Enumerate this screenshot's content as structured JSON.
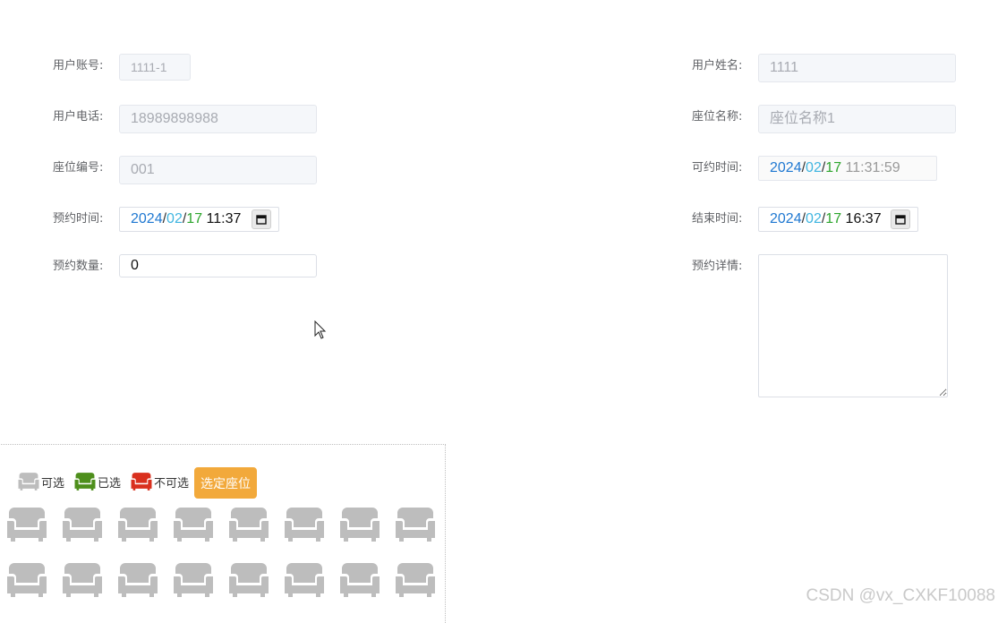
{
  "form": {
    "account_label": "用户账号:",
    "account_value": "1111-1",
    "name_label": "用户姓名:",
    "name_value": "1111",
    "phone_label": "用户电话:",
    "phone_value": "18989898988",
    "seat_name_label": "座位名称:",
    "seat_name_value": "座位名称1",
    "seat_no_label": "座位编号:",
    "seat_no_value": "001",
    "available_label": "可约时间:",
    "available": {
      "year": "2024",
      "month": "02",
      "day": "17",
      "time": "11:31:59"
    },
    "reserve_label": "预约时间:",
    "reserve": {
      "year": "2024",
      "month": "02",
      "day": "17",
      "time": "11:37"
    },
    "end_label": "结束时间:",
    "end": {
      "year": "2024",
      "month": "02",
      "day": "17",
      "time": "16:37"
    },
    "count_label": "预约数量:",
    "count_value": "0",
    "detail_label": "预约详情:",
    "detail_value": ""
  },
  "seat_picker": {
    "legend": {
      "available": "可选",
      "selected": "已选",
      "unavailable": "不可选"
    },
    "select_button": "选定座位",
    "rows": 2,
    "seats_per_row": 8,
    "seat_state": "available"
  },
  "colors": {
    "seat_available": "#bdbdbd",
    "seat_selected": "#4e8f1c",
    "seat_unavailable": "#d9301e",
    "select_button": "#f2a93b"
  },
  "watermark": "CSDN @vx_CXKF10088"
}
